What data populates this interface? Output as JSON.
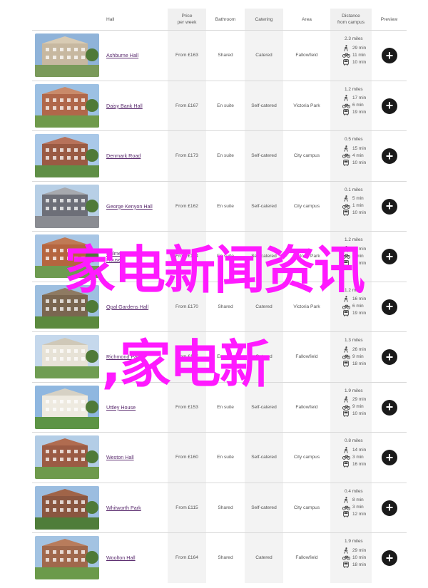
{
  "headers": {
    "hall": "Hall",
    "price_line1": "Price",
    "price_line2": "per week",
    "bathroom": "Bathroom",
    "catering": "Catering",
    "area": "Area",
    "distance_line1": "Distance",
    "distance_line2": "from campus",
    "preview": "Preview"
  },
  "rows": [
    {
      "name": "Ashburne Hall",
      "price": "From £163",
      "bathroom": "Shared",
      "catering": "Catered",
      "area": "Fallowfield",
      "miles": "2.3 miles",
      "walk": "29 min",
      "bike": "11 min",
      "bus": "10 min"
    },
    {
      "name": "Daisy Bank Hall",
      "price": "From £167",
      "bathroom": "En suite",
      "catering": "Self-catered",
      "area": "Victoria Park",
      "miles": "1.2 miles",
      "walk": "17 min",
      "bike": "6 min",
      "bus": "19 min"
    },
    {
      "name": "Denmark Road",
      "price": "From £173",
      "bathroom": "En suite",
      "catering": "Self-catered",
      "area": "City campus",
      "miles": "0.5 miles",
      "walk": "15 min",
      "bike": "4 min",
      "bus": "10 min"
    },
    {
      "name": "George Kenyon Hall",
      "price": "From £162",
      "bathroom": "En suite",
      "catering": "Self-catered",
      "area": "City campus",
      "miles": "0.1 miles",
      "walk": "5 min",
      "bike": "1 min",
      "bus": "10 min"
    },
    {
      "name": "Hulme Hall: Burkhardt House",
      "price": "From £154",
      "bathroom": "En suite",
      "catering": "Self-catered",
      "area": "Victoria Park",
      "miles": "1.2 miles",
      "walk": "16 min",
      "bike": "6 min",
      "bus": "10 min"
    },
    {
      "name": "Opal Gardens Hall",
      "price": "From £170",
      "bathroom": "Shared",
      "catering": "Catered",
      "area": "Victoria Park",
      "miles": "1.2 miles",
      "walk": "16 min",
      "bike": "6 min",
      "bus": "19 min"
    },
    {
      "name": "Richmond Park",
      "price": "From £157",
      "bathroom": "En suite",
      "catering": "Catered",
      "area": "Fallowfield",
      "miles": "1.3 miles",
      "walk": "26 min",
      "bike": "9 min",
      "bus": "18 min"
    },
    {
      "name": "Uttley House",
      "price": "From £153",
      "bathroom": "En suite",
      "catering": "Self-catered",
      "area": "Fallowfield",
      "miles": "1.9 miles",
      "walk": "29 min",
      "bike": "9 min",
      "bus": "10 min"
    },
    {
      "name": "Weston Hall",
      "price": "From £160",
      "bathroom": "En suite",
      "catering": "Self-catered",
      "area": "City campus",
      "miles": "0.8 miles",
      "walk": "14 min",
      "bike": "3 min",
      "bus": "16 min"
    },
    {
      "name": "Whitworth Park",
      "price": "From £115",
      "bathroom": "Shared",
      "catering": "Self-catered",
      "area": "City campus",
      "miles": "0.4 miles",
      "walk": "8 min",
      "bike": "3 min",
      "bus": "12 min"
    },
    {
      "name": "Woolton Hall",
      "price": "From £164",
      "bathroom": "Shared",
      "catering": "Catered",
      "area": "Fallowfield",
      "miles": "1.9 miles",
      "walk": "29 min",
      "bike": "10 min",
      "bus": "18 min"
    }
  ],
  "overlay": {
    "line1": "家电新闻资讯",
    "line2": ",家电新"
  },
  "colors": {
    "link": "#5b2c6f",
    "overlay": "#ff1aff",
    "shaded_column": "#f3f3f3",
    "preview_button": "#1a1a1a"
  },
  "icons": [
    "walk-icon",
    "bike-icon",
    "bus-icon",
    "plus-icon"
  ]
}
